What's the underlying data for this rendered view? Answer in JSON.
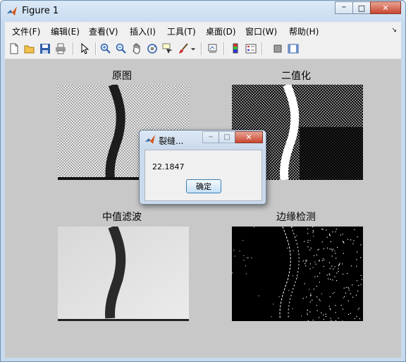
{
  "window": {
    "title": "Figure 1",
    "minimize": "─",
    "maximize": "□",
    "close": "✕"
  },
  "menu": [
    {
      "label": "文件(F)"
    },
    {
      "label": "编辑(E)"
    },
    {
      "label": "查看(V)"
    },
    {
      "label": "插入(I)"
    },
    {
      "label": "工具(T)"
    },
    {
      "label": "桌面(D)"
    },
    {
      "label": "窗口(W)"
    },
    {
      "label": "帮助(H)"
    }
  ],
  "menu_overflow": "↘",
  "toolbar": [
    "new-figure-icon",
    "open-file-icon",
    "save-icon",
    "print-icon",
    "pointer-icon",
    "zoom-in-icon",
    "zoom-out-icon",
    "pan-hand-icon",
    "rotate-3d-icon",
    "data-cursor-icon",
    "brush-icon",
    "brush-dropdown-icon",
    "link-plot-icon",
    "colorbar-icon",
    "legend-icon",
    "hide-plot-tools-icon",
    "show-plot-tools-icon"
  ],
  "plots": [
    {
      "title": "原图"
    },
    {
      "title": "二值化"
    },
    {
      "title": "中值滤波"
    },
    {
      "title": "边缘检测"
    }
  ],
  "dialog": {
    "title": "裂缝...",
    "message": "22.1847",
    "ok_label": "确定"
  },
  "colors": {
    "figure_bg": "#c8c8c8",
    "title_bar": "#c9dcf0",
    "close_button": "#c8462f"
  }
}
